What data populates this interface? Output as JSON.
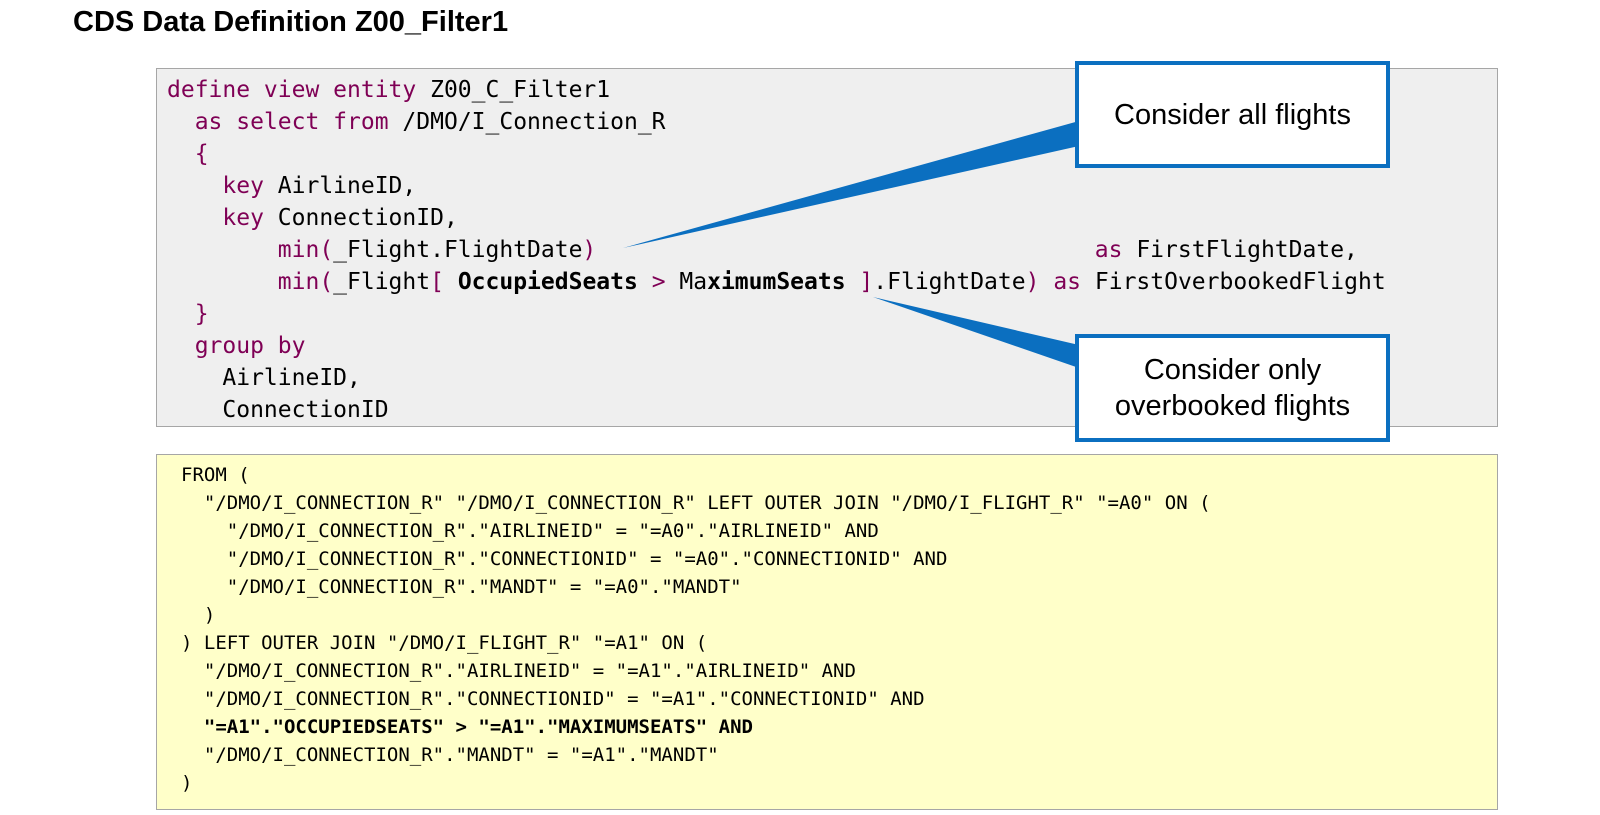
{
  "title": "CDS Data Definition Z00_Filter1",
  "cds_code": {
    "l1_kw": "define view entity",
    "l1_name": " Z00_C_Filter1",
    "l2_kw": "as select from",
    "l2_src": " /DMO/I_Connection_R",
    "l3_brace": "{",
    "l4_kw": "key",
    "l4_field": " AirlineID,",
    "l5_kw": "key",
    "l5_field": " ConnectionID,",
    "l6_func": "min(",
    "l6_arg": "_Flight.FlightDate",
    "l6_close": ")",
    "l6_as": "as",
    "l6_alias": " FirstFlightDate,",
    "l7_func": "min(",
    "l7_arg1": "_Flight",
    "l7_bracket_open": "[",
    "l7_cond_left": " OccupiedSeats",
    "l7_op": " > ",
    "l7_cond_ma": "Ma",
    "l7_cond_right": "ximumSeats",
    "l7_bracket_close": " ]",
    "l7_rest": ".FlightDate",
    "l7_close": ")",
    "l7_as": "as",
    "l7_alias": " FirstOverbookedFlight",
    "l8_brace": "}",
    "l9_kw": "group by",
    "l10_field": "AirlineID,",
    "l11_field": "ConnectionID"
  },
  "sql": {
    "lines": [
      "FROM (",
      "  \"/DMO/I_CONNECTION_R\" \"/DMO/I_CONNECTION_R\" LEFT OUTER JOIN \"/DMO/I_FLIGHT_R\" \"=A0\" ON (",
      "    \"/DMO/I_CONNECTION_R\".\"AIRLINEID\" = \"=A0\".\"AIRLINEID\" AND",
      "    \"/DMO/I_CONNECTION_R\".\"CONNECTIONID\" = \"=A0\".\"CONNECTIONID\" AND",
      "    \"/DMO/I_CONNECTION_R\".\"MANDT\" = \"=A0\".\"MANDT\"",
      "  )",
      ") LEFT OUTER JOIN \"/DMO/I_FLIGHT_R\" \"=A1\" ON (",
      "  \"/DMO/I_CONNECTION_R\".\"AIRLINEID\" = \"=A1\".\"AIRLINEID\" AND",
      "  \"/DMO/I_CONNECTION_R\".\"CONNECTIONID\" = \"=A1\".\"CONNECTIONID\" AND",
      "  \"=A1\".\"OCCUPIEDSEATS\" > \"=A1\".\"MAXIMUMSEATS\" AND",
      "  \"/DMO/I_CONNECTION_R\".\"MANDT\" = \"=A1\".\"MANDT\"",
      ")"
    ],
    "bold_line_index": 9
  },
  "callouts": {
    "all_flights": "Consider all flights",
    "overbooked_line1": "Consider only",
    "overbooked_line2": "overbooked flights"
  },
  "colors": {
    "keyword": "#7f0055",
    "callout_border": "#0b6fc0",
    "code_bg": "#efefef",
    "sql_bg": "#ffffc9"
  }
}
